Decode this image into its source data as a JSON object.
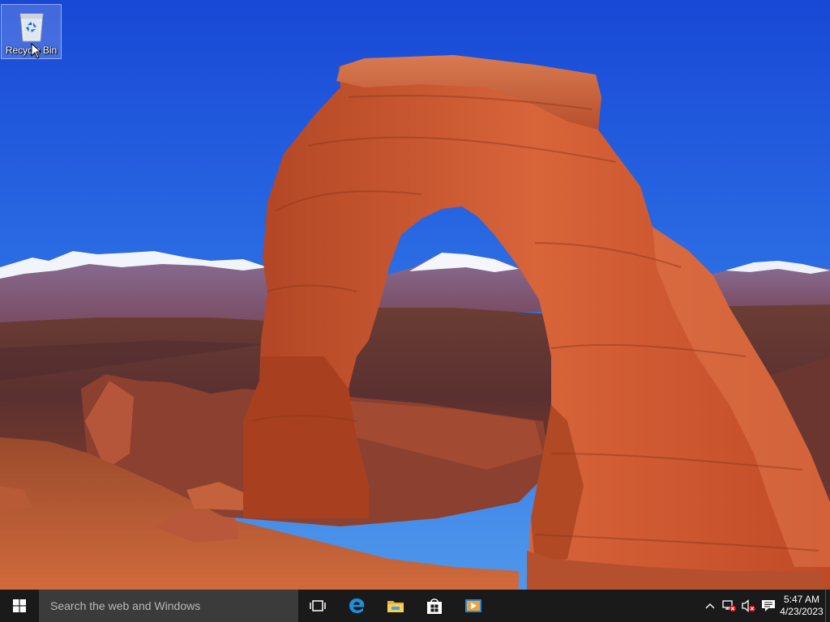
{
  "desktop": {
    "wallpaper": "desert-arch-landscape",
    "icons": [
      {
        "label": "Recycle Bin",
        "icon": "recycle-bin-icon"
      }
    ]
  },
  "taskbar": {
    "start_icon": "windows-logo-icon",
    "search_placeholder": "Search the web and Windows",
    "pinned": [
      {
        "name": "Task View",
        "icon": "task-view-icon"
      },
      {
        "name": "Microsoft Edge",
        "icon": "edge-icon"
      },
      {
        "name": "File Explorer",
        "icon": "folder-icon"
      },
      {
        "name": "Store",
        "icon": "store-icon"
      },
      {
        "name": "Media Player",
        "icon": "media-player-icon"
      }
    ],
    "tray": {
      "icons": [
        "chevron-up-icon",
        "network-disconnected-icon",
        "volume-muted-icon",
        "action-center-icon"
      ],
      "time": "5:47 AM",
      "date": "4/23/2023"
    }
  },
  "colors": {
    "taskbar_bg": "#1a1a1a",
    "search_bg": "#3b3b3b",
    "edge_blue": "#1e8fd8",
    "sky_top": "#1c4fd8",
    "rock": "#c9522a",
    "error_red": "#e81123"
  }
}
